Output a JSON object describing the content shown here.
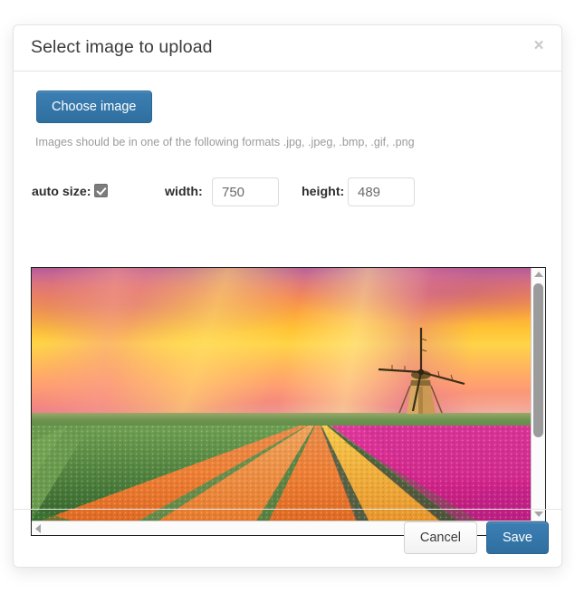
{
  "dialog": {
    "title": "Select image to upload",
    "close_label": "×",
    "close_icon": "close-icon"
  },
  "body": {
    "choose_button_label": "Choose image",
    "format_hint": "Images should be in one of the following formats .jpg, .jpeg, .bmp, .gif, .png",
    "fields": {
      "auto_size_label": "auto size:",
      "auto_size_checked": true,
      "width_label": "width:",
      "width_value": "750",
      "height_label": "height:",
      "height_value": "489"
    },
    "preview": {
      "alt": "Sunset over a Dutch tulip field with a windmill",
      "scroll_icons": {
        "up": "chevron-up-icon",
        "down": "chevron-down-icon",
        "left": "chevron-left-icon",
        "right": "chevron-right-icon"
      }
    }
  },
  "footer": {
    "cancel_label": "Cancel",
    "save_label": "Save"
  },
  "colors": {
    "primary": "#3c7fb4",
    "primary_border": "#2a6496",
    "text": "#3b3b3b",
    "muted": "#9b9b9b",
    "border": "#e5e5e5"
  }
}
